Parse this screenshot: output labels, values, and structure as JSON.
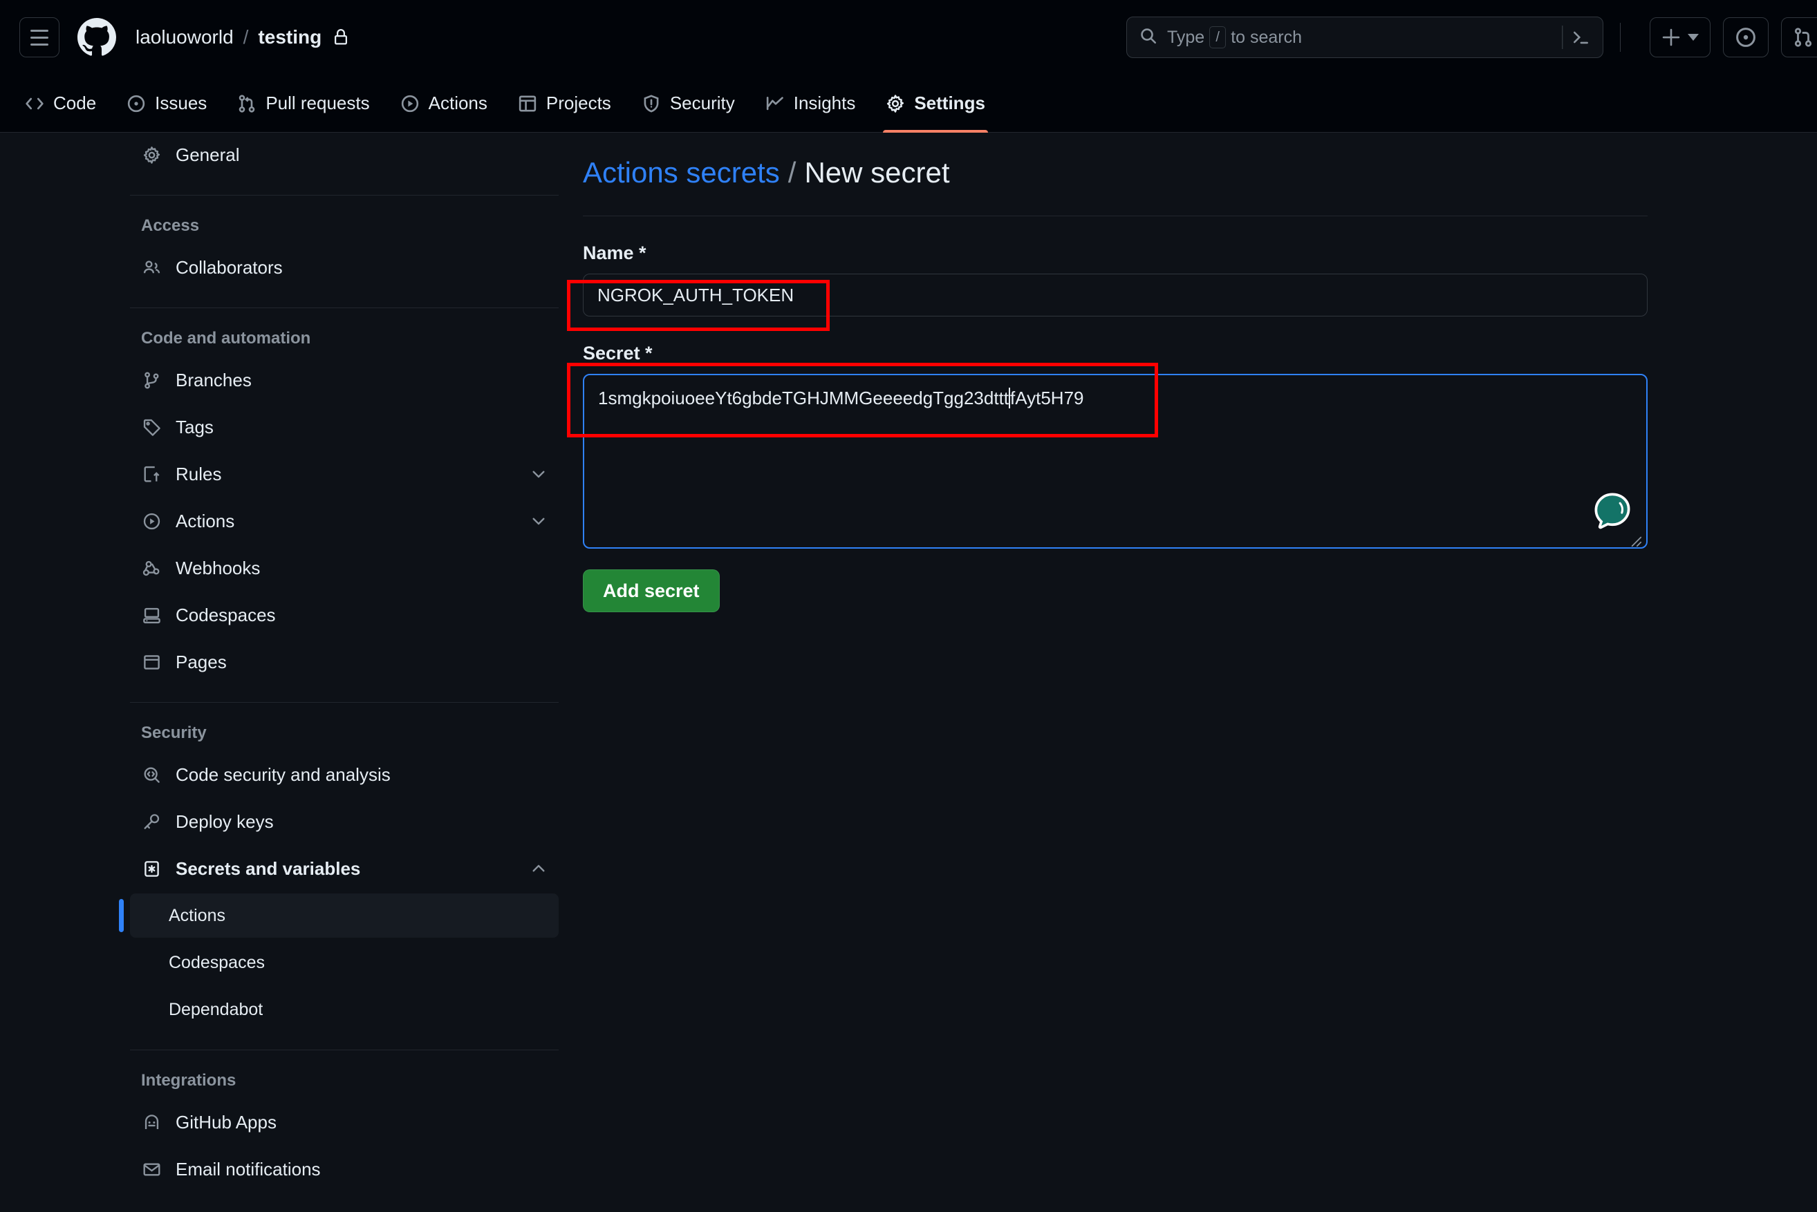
{
  "header": {
    "menu_icon": "hamburger-icon",
    "logo_icon": "github-logo-icon",
    "owner": "laoluoworld",
    "separator": "/",
    "repo": "testing",
    "visibility_icon": "lock-icon",
    "search": {
      "placeholder_prefix": "Type",
      "placeholder_key": "/",
      "placeholder_suffix": "to search",
      "search_icon": "search-icon",
      "terminal_icon": "terminal-icon"
    },
    "create_new_label": "+",
    "create_new_icon": "plus-icon",
    "issues_icon": "issue-opened-icon",
    "pull_requests_icon": "pull-request-icon"
  },
  "repo_nav": {
    "tabs": [
      {
        "label": "Code",
        "icon": "code-icon",
        "active": false
      },
      {
        "label": "Issues",
        "icon": "issue-opened-icon",
        "active": false
      },
      {
        "label": "Pull requests",
        "icon": "git-pull-request-icon",
        "active": false
      },
      {
        "label": "Actions",
        "icon": "play-icon",
        "active": false
      },
      {
        "label": "Projects",
        "icon": "table-icon",
        "active": false
      },
      {
        "label": "Security",
        "icon": "shield-icon",
        "active": false
      },
      {
        "label": "Insights",
        "icon": "graph-icon",
        "active": false
      },
      {
        "label": "Settings",
        "icon": "gear-icon",
        "active": true
      }
    ],
    "active_underline_color": "#f78166"
  },
  "sidebar": {
    "general": {
      "label": "General",
      "icon": "gear-icon"
    },
    "groups": [
      {
        "title": "Access",
        "items": [
          {
            "label": "Collaborators",
            "icon": "people-icon",
            "collapsible": false
          }
        ]
      },
      {
        "title": "Code and automation",
        "items": [
          {
            "label": "Branches",
            "icon": "git-branch-icon",
            "collapsible": false
          },
          {
            "label": "Tags",
            "icon": "tag-icon",
            "collapsible": false
          },
          {
            "label": "Rules",
            "icon": "rules-icon",
            "collapsible": true
          },
          {
            "label": "Actions",
            "icon": "play-icon",
            "collapsible": true
          },
          {
            "label": "Webhooks",
            "icon": "webhook-icon",
            "collapsible": false
          },
          {
            "label": "Codespaces",
            "icon": "codespaces-icon",
            "collapsible": false
          },
          {
            "label": "Pages",
            "icon": "browser-icon",
            "collapsible": false
          }
        ]
      },
      {
        "title": "Security",
        "items": [
          {
            "label": "Code security and analysis",
            "icon": "code-scan-icon",
            "collapsible": false
          },
          {
            "label": "Deploy keys",
            "icon": "key-icon",
            "collapsible": false
          }
        ]
      }
    ],
    "secrets": {
      "label": "Secrets and variables",
      "icon": "asterisk-key-icon",
      "expanded": true,
      "children": [
        {
          "label": "Actions",
          "active": true
        },
        {
          "label": "Codespaces",
          "active": false
        },
        {
          "label": "Dependabot",
          "active": false
        }
      ]
    },
    "integrations": {
      "title": "Integrations",
      "items": [
        {
          "label": "GitHub Apps",
          "icon": "github-app-icon"
        },
        {
          "label": "Email notifications",
          "icon": "mail-icon"
        }
      ]
    },
    "active_indicator_color": "#2f81f7"
  },
  "main": {
    "breadcrumb_link": "Actions secrets",
    "breadcrumb_separator": "/",
    "breadcrumb_current": "New secret",
    "name_field": {
      "label": "Name *",
      "value": "NGROK_AUTH_TOKEN",
      "placeholder": ""
    },
    "secret_field": {
      "label": "Secret *",
      "value_before_caret": "1smgkpoiuoeeYt6gbdeTGHJMMGeeeedgTgg23dttt",
      "value_after_caret": "fAyt5H79",
      "full_value": "1smgkpoiuoeeYt6gbdeTGHJMMGeeeedgTgg23dtttfAyt5H79",
      "placeholder": "",
      "focused": true,
      "focus_border_color": "#2f81f7"
    },
    "submit_button": {
      "label": "Add secret",
      "color": "#238636"
    },
    "chat_widget_icon": "chat-bubble-icon",
    "resize_handle_icon": "resize-grip-icon"
  },
  "annotations": [
    {
      "name": "name-field-highlight",
      "color": "#ff0000"
    },
    {
      "name": "secret-field-highlight",
      "color": "#ff0000"
    }
  ]
}
